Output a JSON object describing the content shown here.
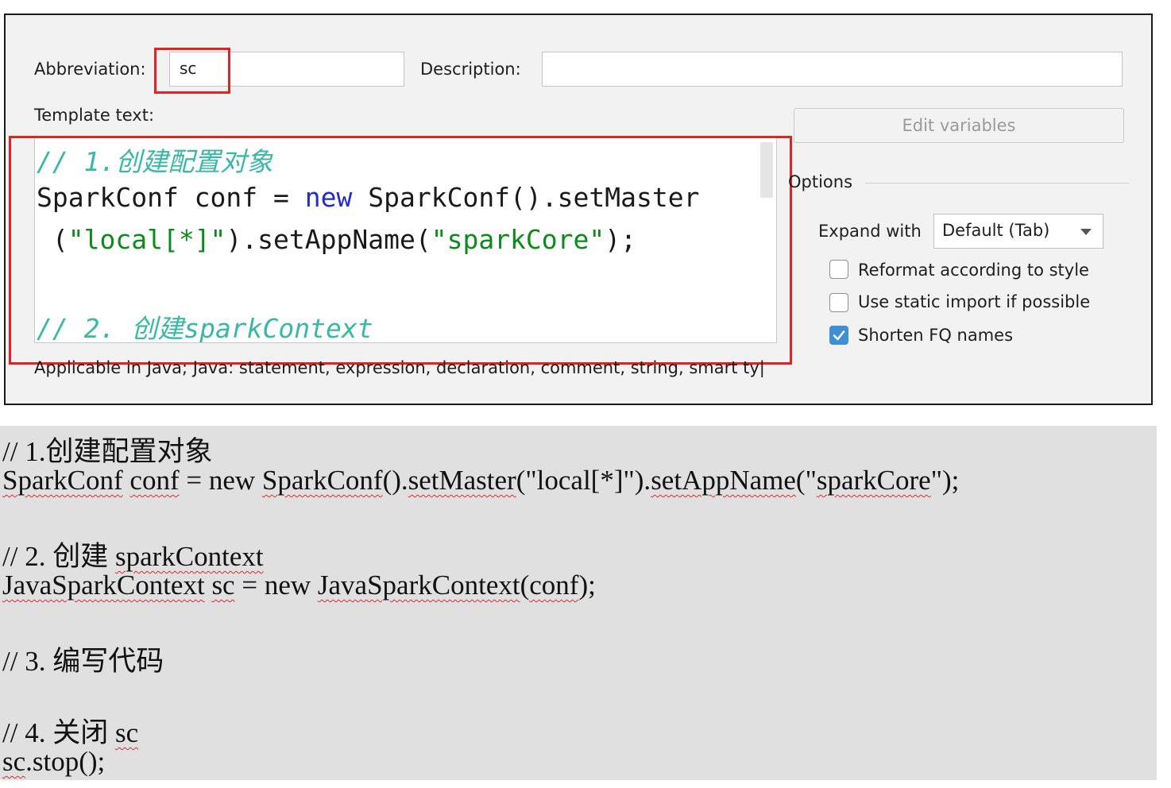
{
  "dialog": {
    "abbreviation_label": "Abbreviation:",
    "abbreviation_value": "sc",
    "description_label": "Description:",
    "description_value": "",
    "template_label": "Template text:",
    "edit_variables": "Edit variables",
    "options_title": "Options",
    "expand_label": "Expand with",
    "expand_value": "Default (Tab)",
    "checkboxes": [
      {
        "label": "Reformat according to style",
        "checked": false
      },
      {
        "label": "Use static import if possible",
        "checked": false
      },
      {
        "label": "Shorten FQ names",
        "checked": true
      }
    ],
    "applicable": "Applicable in Java; Java: statement, expression, declaration, comment, string, smart ty|"
  },
  "editor": {
    "comment1": "// 1.创建配置对象",
    "line1": {
      "a": "SparkConf conf = ",
      "kw": "new",
      "b": " SparkConf().setMaster"
    },
    "line2": {
      "a": " (",
      "s1": "\"local[*]\"",
      "b": ").setAppName(",
      "s2": "\"sparkCore\"",
      "c": ");"
    },
    "comment2": "// 2. 创建sparkContext"
  },
  "colors": {
    "highlight": "#e02424",
    "comment": "#3ab8a6",
    "keyword": "#1f2ec8",
    "string": "#0c8a1a",
    "check": "#3d8fd6"
  },
  "doc": {
    "l1": "// 1.创建配置对象",
    "l2": {
      "a": "SparkConf",
      "b": " ",
      "c": "conf",
      "d": " = new ",
      "e": "SparkConf",
      "f": "().",
      "g": "setMaster",
      "h": "(\"local[*]\").",
      "i": "setAppName",
      "j": "(\"",
      "k": "sparkCore",
      "l": "\");"
    },
    "l3": {
      "a": "// 2. 创建 ",
      "b": "sparkContext"
    },
    "l4": {
      "a": "JavaSparkContext",
      "b": " ",
      "c": "sc",
      "d": " = new ",
      "e": "JavaSparkContext",
      "f": "(",
      "g": "conf",
      "h": ");"
    },
    "l5": "// 3. 编写代码",
    "l6": {
      "a": "// 4. 关闭 ",
      "b": "sc"
    },
    "l7": {
      "a": "sc",
      "b": ".stop();"
    }
  }
}
